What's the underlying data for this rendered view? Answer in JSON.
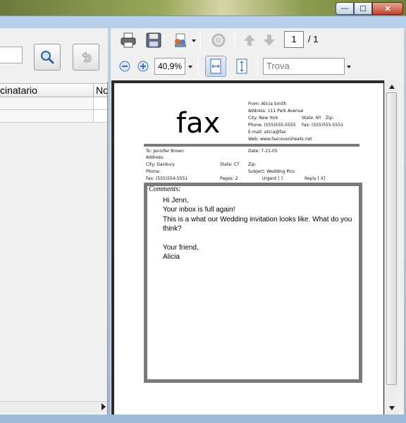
{
  "window": {
    "controls": {
      "minimize": "—",
      "maximize": "☐",
      "close": "✕"
    }
  },
  "left": {
    "grid": {
      "col1": "cinatario",
      "col2": "No"
    }
  },
  "viewer": {
    "page_current": "1",
    "page_total": "/ 1",
    "zoom": "40,9%",
    "find_placeholder": "Trova"
  },
  "doc": {
    "title": "fax",
    "from": "From: Alicia Smith",
    "address": "Address: 111 Park Avenue",
    "city": "City: New York",
    "state": "State: NY",
    "zip": "Zip:",
    "phone": "Phone: (555)555-5555",
    "fax_no": "Fax: (555)555-5551",
    "email": "E-mail: alicia@fax",
    "web": "Web: www.faxcoversheets.net",
    "to": "To: Jennifer Brown",
    "date": "Date: 7-21-05",
    "to_address": "Address:",
    "to_city": "City: Danbury",
    "to_state": "State: CT",
    "to_zip": "Zip:",
    "to_phone": "Phone:",
    "subject": "Subject: Wedding Pics",
    "to_fax": "Fax: (555)554-5551",
    "pages": "Pages: 2",
    "urgent": "Urgent [ ]",
    "reply": "Reply [ X]",
    "comments_label": "Comments:",
    "body": [
      "Hi Jenn,",
      "Your inbox is full again!",
      "This is a what our Wedding invitation looks like. What do you think?",
      "",
      "Your friend,",
      "Alicia"
    ]
  }
}
